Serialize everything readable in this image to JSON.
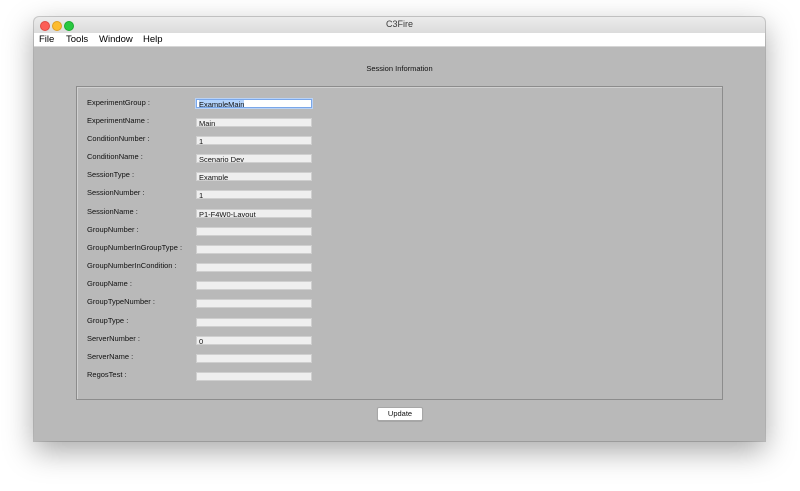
{
  "window": {
    "title": "C3Fire"
  },
  "menu": [
    {
      "label": "File"
    },
    {
      "label": "Tools"
    },
    {
      "label": "Window"
    },
    {
      "label": "Help"
    }
  ],
  "heading": "Session Information",
  "fields": [
    {
      "label": "ExperimentGroup :",
      "value": "ExampleMain"
    },
    {
      "label": "ExperimentName :",
      "value": "Main"
    },
    {
      "label": "ConditionNumber :",
      "value": "1"
    },
    {
      "label": "ConditionName :",
      "value": "Scenario Dev"
    },
    {
      "label": "SessionType :",
      "value": "Example"
    },
    {
      "label": "SessionNumber :",
      "value": "1"
    },
    {
      "label": "SessionName :",
      "value": "P1-F4W0-Layout"
    },
    {
      "label": "GroupNumber :",
      "value": ""
    },
    {
      "label": "GroupNumberInGroupType :",
      "value": ""
    },
    {
      "label": "GroupNumberInCondition :",
      "value": ""
    },
    {
      "label": "GroupName :",
      "value": ""
    },
    {
      "label": "GroupTypeNumber :",
      "value": ""
    },
    {
      "label": "GroupType :",
      "value": ""
    },
    {
      "label": "ServerNumber :",
      "value": "0"
    },
    {
      "label": "ServerName :",
      "value": ""
    },
    {
      "label": "RegosTest :",
      "value": ""
    }
  ],
  "update_label": "Update"
}
